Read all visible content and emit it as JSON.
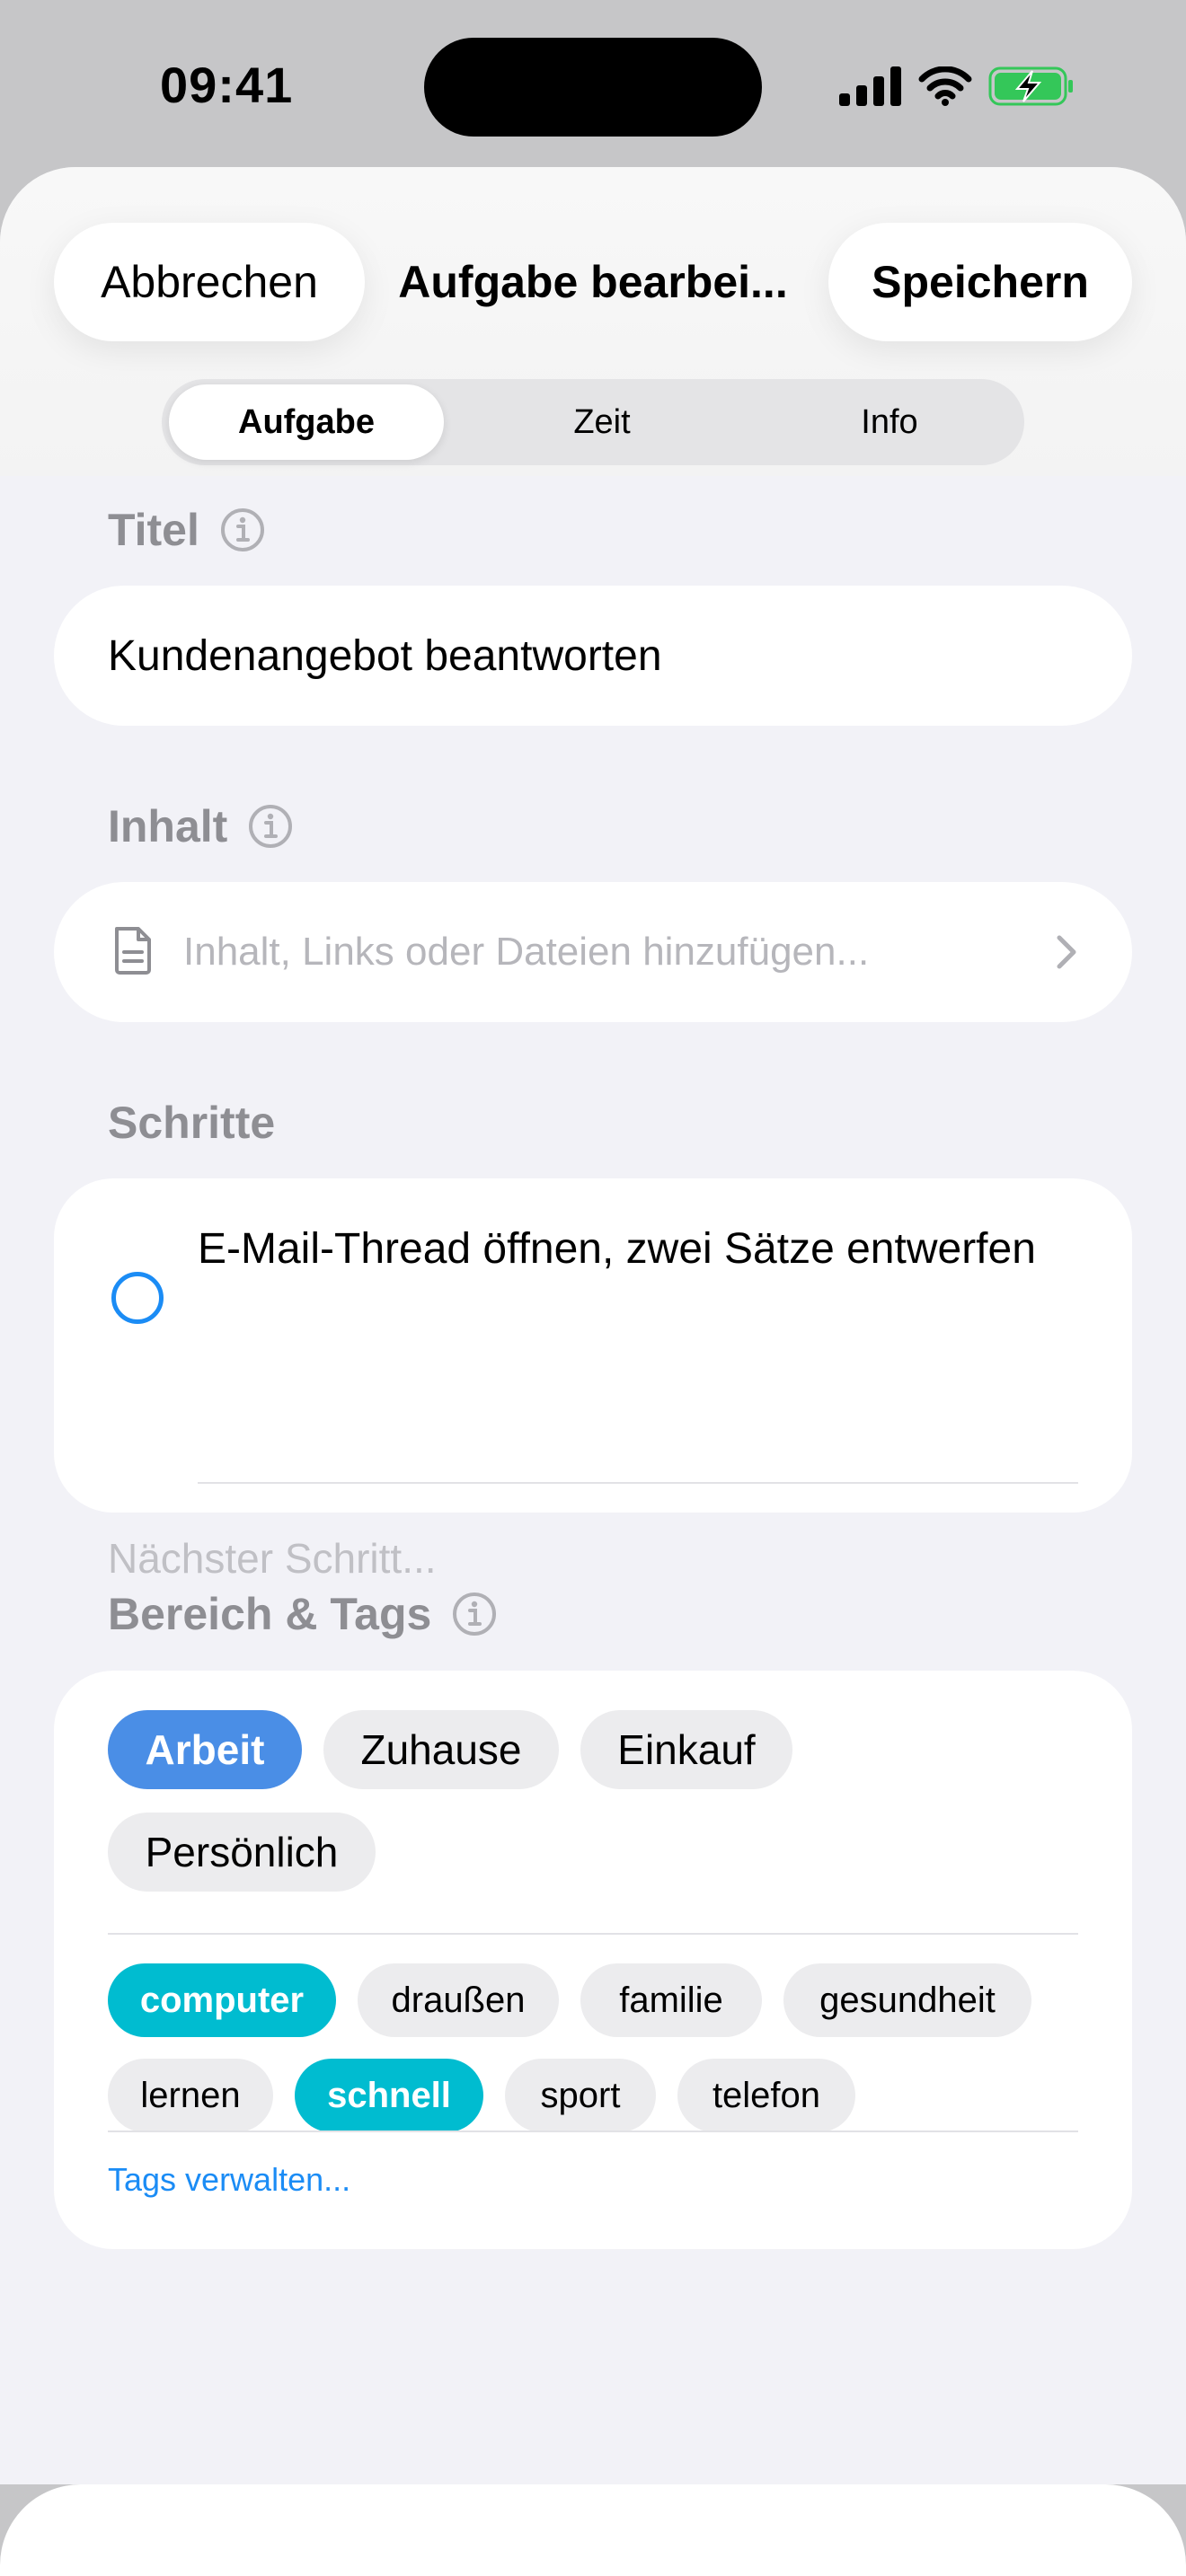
{
  "status_bar": {
    "time": "09:41",
    "icons": [
      "signal-icon",
      "wifi-icon",
      "battery-charging-icon"
    ],
    "battery_color": "#34c759"
  },
  "header": {
    "cancel_label": "Abbrechen",
    "title": "Aufgabe bearbei...",
    "save_label": "Speichern"
  },
  "tabs": [
    {
      "label": "Aufgabe",
      "selected": true
    },
    {
      "label": "Zeit",
      "selected": false
    },
    {
      "label": "Info",
      "selected": false
    }
  ],
  "title_section": {
    "label": "Titel",
    "value": "Kundenangebot beantworten"
  },
  "content_section": {
    "label": "Inhalt",
    "placeholder": "Inhalt, Links oder Dateien hinzufügen..."
  },
  "steps_section": {
    "label": "Schritte",
    "steps": [
      {
        "text": "E-Mail-Thread öffnen, zwei Sätze entwerfen",
        "done": false
      }
    ],
    "next_placeholder": "Nächster Schritt..."
  },
  "areas_section": {
    "label": "Bereich & Tags",
    "areas": [
      {
        "label": "Arbeit",
        "selected": true
      },
      {
        "label": "Zuhause",
        "selected": false
      },
      {
        "label": "Einkauf",
        "selected": false
      },
      {
        "label": "Persönlich",
        "selected": false
      }
    ],
    "tags": [
      {
        "label": "computer",
        "selected": true
      },
      {
        "label": "draußen",
        "selected": false
      },
      {
        "label": "familie",
        "selected": false
      },
      {
        "label": "gesundheit",
        "selected": false
      },
      {
        "label": "lernen",
        "selected": false
      },
      {
        "label": "schnell",
        "selected": true
      },
      {
        "label": "sport",
        "selected": false
      },
      {
        "label": "telefon",
        "selected": false
      }
    ],
    "manage_label": "Tags verwalten...",
    "colors": {
      "area_selected": "#4a8ee6",
      "tag_selected": "#00bcd0",
      "link": "#1b8cf5"
    }
  }
}
